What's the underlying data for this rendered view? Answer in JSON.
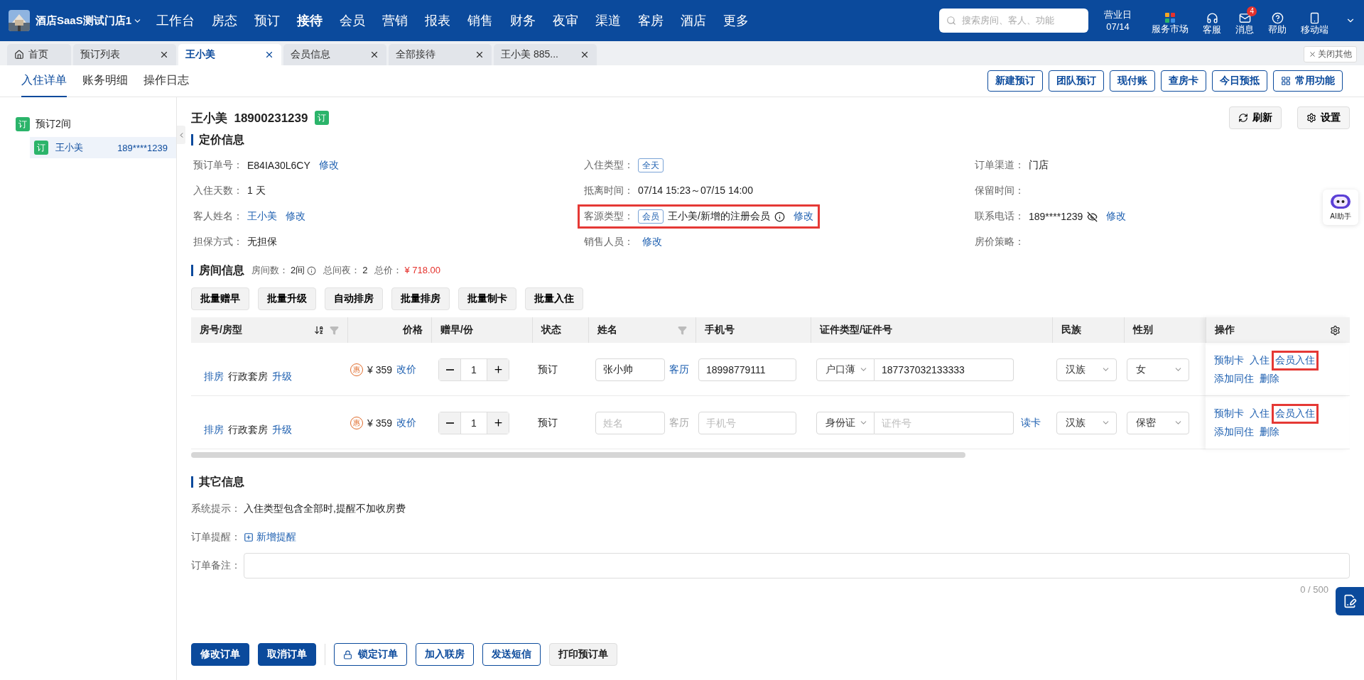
{
  "header": {
    "store": "酒店SaaS测试门店1",
    "nav": [
      {
        "label": "工作台",
        "selected": false
      },
      {
        "label": "房态",
        "selected": false
      },
      {
        "label": "预订",
        "selected": false
      },
      {
        "label": "接待",
        "selected": true
      },
      {
        "label": "会员",
        "selected": false
      },
      {
        "label": "营销",
        "selected": false
      },
      {
        "label": "报表",
        "selected": false
      },
      {
        "label": "销售",
        "selected": false
      },
      {
        "label": "财务",
        "selected": false
      },
      {
        "label": "夜审",
        "selected": false
      },
      {
        "label": "渠道",
        "selected": false
      },
      {
        "label": "客房",
        "selected": false
      },
      {
        "label": "酒店",
        "selected": false
      },
      {
        "label": "更多",
        "selected": false
      }
    ],
    "search": {
      "placeholder": "搜索房间、客人、功能"
    },
    "business_day": {
      "label": "营业日",
      "value": "07/14"
    },
    "tools": [
      {
        "kind": "market",
        "label": "服务市场"
      },
      {
        "kind": "support",
        "label": "客服"
      },
      {
        "kind": "message",
        "label": "消息",
        "badge": "4"
      },
      {
        "kind": "help",
        "label": "帮助"
      },
      {
        "kind": "mobile",
        "label": "移动端"
      }
    ]
  },
  "page_tabs": [
    {
      "label": "首页",
      "selected": false,
      "kind": "home"
    },
    {
      "label": "预订列表",
      "selected": false,
      "kind": "closable"
    },
    {
      "label": "王小美",
      "selected": true,
      "kind": "closable"
    },
    {
      "label": "会员信息",
      "selected": false,
      "kind": "closable"
    },
    {
      "label": "全部接待",
      "selected": false,
      "kind": "closable"
    },
    {
      "label": "王小美 885...",
      "selected": false,
      "kind": "closable"
    }
  ],
  "close_others": "关闭其他",
  "sub_tabs": [
    {
      "label": "入住详单",
      "selected": true
    },
    {
      "label": "账务明细",
      "selected": false
    },
    {
      "label": "操作日志",
      "selected": false
    }
  ],
  "actions": [
    {
      "label": "新建预订",
      "kind": "text"
    },
    {
      "label": "团队预订",
      "kind": "text"
    },
    {
      "label": "现付账",
      "kind": "text"
    },
    {
      "label": "查房卡",
      "kind": "text"
    },
    {
      "label": "今日预抵",
      "kind": "text"
    },
    {
      "label": "常用功能",
      "kind": "grid"
    }
  ],
  "sidebar": {
    "group": {
      "badge": "订",
      "label": "预订2间"
    },
    "items": [
      {
        "badge": "订",
        "name": "王小美",
        "phone": "189****1239",
        "selected": true
      }
    ]
  },
  "guest": {
    "name": "王小美",
    "phone": "18900231239",
    "badge": "订"
  },
  "top_buttons": [
    {
      "label": "刷新",
      "kind": "refresh"
    },
    {
      "label": "设置",
      "kind": "settings"
    }
  ],
  "pricing": {
    "title": "定价信息",
    "fields": [
      {
        "label": "预订单号：",
        "value": "E84IA30L6CY",
        "link": "修改"
      },
      {
        "label": "入住类型：",
        "tag": "全天"
      },
      {
        "label": "订单渠道：",
        "value": "门店"
      },
      {
        "label": "入住天数：",
        "value": "1 天"
      },
      {
        "label": "抵离时间：",
        "value": "07/14 15:23～07/15 14:00"
      },
      {
        "label": "保留时间："
      },
      {
        "label": "客人姓名：",
        "value": "王小美",
        "value_link": true,
        "link": "修改"
      },
      {
        "label": "客源类型：",
        "tag": "会员",
        "value": "王小美/新增的注册会员",
        "kind": "info",
        "link": "修改",
        "highlighted": true
      },
      {
        "label": "联系电话：",
        "value": "189****1239",
        "kind": "hidden",
        "link": "修改"
      },
      {
        "label": "担保方式：",
        "value": "无担保"
      },
      {
        "label": "销售人员：",
        "link": "修改"
      },
      {
        "label": "房价策略："
      }
    ]
  },
  "assistant": {
    "label": "AI助手"
  },
  "rooms": {
    "title": "房间信息",
    "stats": [
      {
        "label": "房间数：",
        "value": "2间",
        "info": true
      },
      {
        "label": "总间夜：",
        "value": "2"
      },
      {
        "label": "总价：",
        "value": "¥ 718.00",
        "emphasis": true
      }
    ],
    "batch_buttons": [
      "批量赠早",
      "批量升级",
      "自动排房",
      "批量排房",
      "批量制卡",
      "批量入住"
    ],
    "columns": [
      {
        "label": "房号/房型",
        "sort": true,
        "filter": true
      },
      {
        "label": "价格"
      },
      {
        "label": "赠早/份"
      },
      {
        "label": "状态"
      },
      {
        "label": "姓名",
        "filter": true
      },
      {
        "label": "手机号"
      },
      {
        "label": "证件类型/证件号"
      },
      {
        "label": "民族"
      },
      {
        "label": "性别"
      }
    ],
    "actions_column": "操作",
    "rows": [
      {
        "assign": "排房",
        "room_type": "行政套房",
        "upgrade": "升级",
        "discount": "惠",
        "price": "¥ 359",
        "price_link": "改价",
        "breakfast": "1",
        "status": "预订",
        "name": {
          "value": "张小帅"
        },
        "history": {
          "label": "客历",
          "disabled": false
        },
        "phone": {
          "value": "18998779111"
        },
        "id_type": "户口薄",
        "id_number": {
          "value": "187737032133333"
        },
        "ethnicity": "汉族",
        "gender": "女",
        "actions": [
          {
            "label": "预制卡",
            "highlighted": false
          },
          {
            "label": "入住",
            "highlighted": false
          },
          {
            "label": "会员入住",
            "highlighted": true
          },
          {
            "label": "添加同住",
            "highlighted": false
          },
          {
            "label": "删除",
            "highlighted": false
          }
        ]
      },
      {
        "assign": "排房",
        "room_type": "行政套房",
        "upgrade": "升级",
        "discount": "惠",
        "price": "¥ 359",
        "price_link": "改价",
        "breakfast": "1",
        "status": "预订",
        "name": {
          "placeholder": "姓名"
        },
        "history": {
          "label": "客历",
          "disabled": true
        },
        "phone": {
          "placeholder": "手机号"
        },
        "id_type": "身份证",
        "id_number": {
          "placeholder": "证件号"
        },
        "read_card": "读卡",
        "ethnicity": "汉族",
        "gender": "保密",
        "actions": [
          {
            "label": "预制卡",
            "highlighted": false
          },
          {
            "label": "入住",
            "highlighted": false
          },
          {
            "label": "会员入住",
            "highlighted": true
          },
          {
            "label": "添加同住",
            "highlighted": false
          },
          {
            "label": "删除",
            "highlighted": false
          }
        ]
      }
    ]
  },
  "other": {
    "title": "其它信息",
    "hint_label": "系统提示：",
    "hint": "入住类型包含全部时,提醒不加收房费",
    "reminder_label": "订单提醒：",
    "reminder_link": "新增提醒",
    "remark_label": "订单备注：",
    "counter": "0 / 500"
  },
  "footer_buttons": [
    {
      "label": "修改订单",
      "kind": "primary"
    },
    {
      "label": "取消订单",
      "kind": "primary"
    },
    {
      "label": "锁定订单",
      "kind": "lock"
    },
    {
      "label": "加入联房",
      "kind": "outline"
    },
    {
      "label": "发送短信",
      "kind": "outline"
    },
    {
      "label": "打印预订单",
      "kind": "plain"
    }
  ]
}
